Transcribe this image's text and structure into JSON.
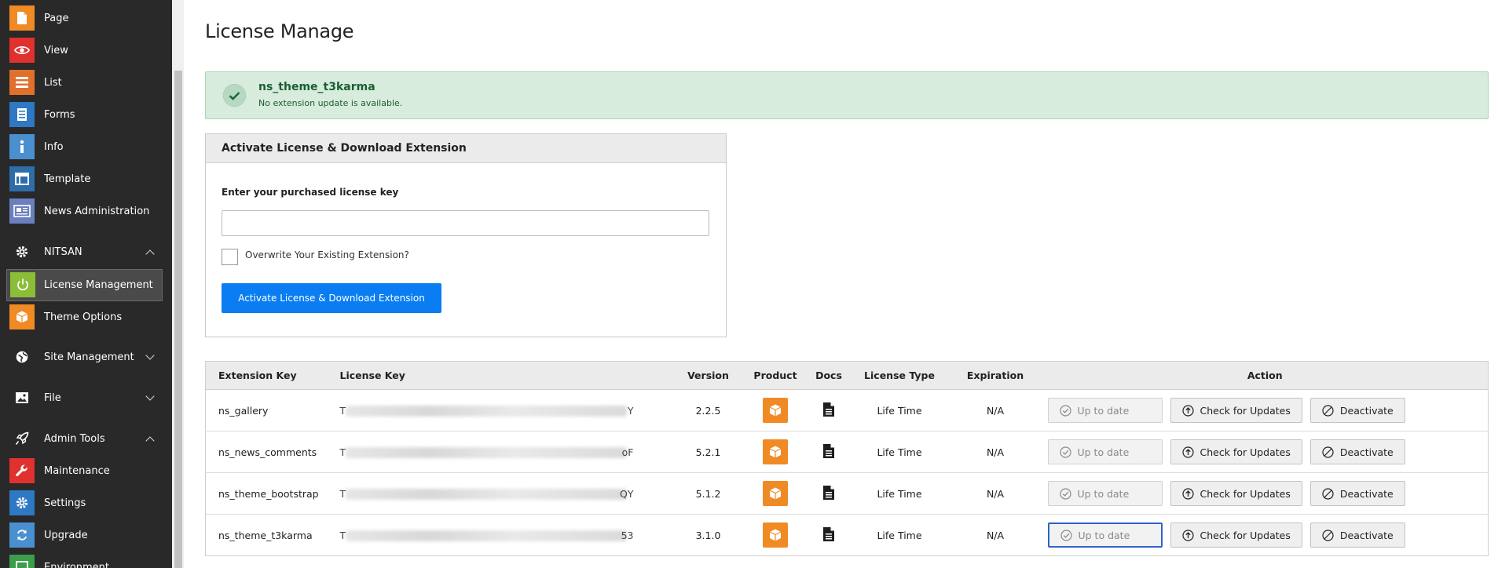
{
  "sidebar": {
    "items": [
      {
        "label": "Page",
        "icon": "page-icon",
        "color": "#f08a24"
      },
      {
        "label": "View",
        "icon": "eye-icon",
        "color": "#e0312f"
      },
      {
        "label": "List",
        "icon": "list-icon",
        "color": "#e0702c"
      },
      {
        "label": "Forms",
        "icon": "forms-icon",
        "color": "#2e78c4"
      },
      {
        "label": "Info",
        "icon": "info-icon",
        "color": "#2e78c4"
      },
      {
        "label": "Template",
        "icon": "template-icon",
        "color": "#2e78c4"
      },
      {
        "label": "News Administration",
        "icon": "news-icon",
        "color": "#6b7fbf"
      }
    ],
    "group_nitsan": {
      "label": "NITSAN",
      "icon": "gear-icon"
    },
    "license_management": {
      "label": "License Management",
      "icon": "power-icon",
      "color": "#8bbd37"
    },
    "theme_options": {
      "label": "Theme Options",
      "icon": "box-icon",
      "color": "#f08a24"
    },
    "group_site": {
      "label": "Site Management",
      "icon": "globe-icon"
    },
    "group_file": {
      "label": "File",
      "icon": "image-icon"
    },
    "group_admin": {
      "label": "Admin Tools",
      "icon": "rocket-icon"
    },
    "admin_items": [
      {
        "label": "Maintenance",
        "icon": "wrench-icon",
        "color": "#e0312f"
      },
      {
        "label": "Settings",
        "icon": "gear-icon",
        "color": "#2e78c4"
      },
      {
        "label": "Upgrade",
        "icon": "refresh-icon",
        "color": "#2e78c4"
      },
      {
        "label": "Environment",
        "icon": "environment-icon",
        "color": "#3c9d4a"
      }
    ]
  },
  "page_title": "License Manage",
  "alert": {
    "title": "ns_theme_t3karma",
    "message": "No extension update is available."
  },
  "activate_panel": {
    "header": "Activate License & Download Extension",
    "license_label": "Enter your purchased license key",
    "license_value": "",
    "overwrite_label": "Overwrite Your Existing Extension?",
    "overwrite_checked": false,
    "submit_label": "Activate License & Download Extension"
  },
  "table": {
    "headers": {
      "ext": "Extension Key",
      "lic": "License Key",
      "ver": "Version",
      "prod": "Product",
      "docs": "Docs",
      "ltype": "License Type",
      "exp": "Expiration",
      "act": "Action"
    },
    "rows": [
      {
        "ext": "ns_gallery",
        "lic_start": "T",
        "lic_end": "Y",
        "ver": "2.2.5",
        "ltype": "Life Time",
        "exp": "N/A"
      },
      {
        "ext": "ns_news_comments",
        "lic_start": "T",
        "lic_end": "oF",
        "ver": "5.2.1",
        "ltype": "Life Time",
        "exp": "N/A"
      },
      {
        "ext": "ns_theme_bootstrap",
        "lic_start": "T",
        "lic_end": "QY",
        "ver": "5.1.2",
        "ltype": "Life Time",
        "exp": "N/A"
      },
      {
        "ext": "ns_theme_t3karma",
        "lic_start": "T",
        "lic_end": "53",
        "ver": "3.1.0",
        "ltype": "Life Time",
        "exp": "N/A"
      }
    ],
    "actions": {
      "uptodate": "Up to date",
      "check": "Check for Updates",
      "deactivate": "Deactivate"
    }
  },
  "colors": {
    "sidebar_bg": "#292929",
    "alert_bg": "#d7ecdd",
    "primary": "#0a7df2",
    "product_orange": "#f08a24"
  }
}
